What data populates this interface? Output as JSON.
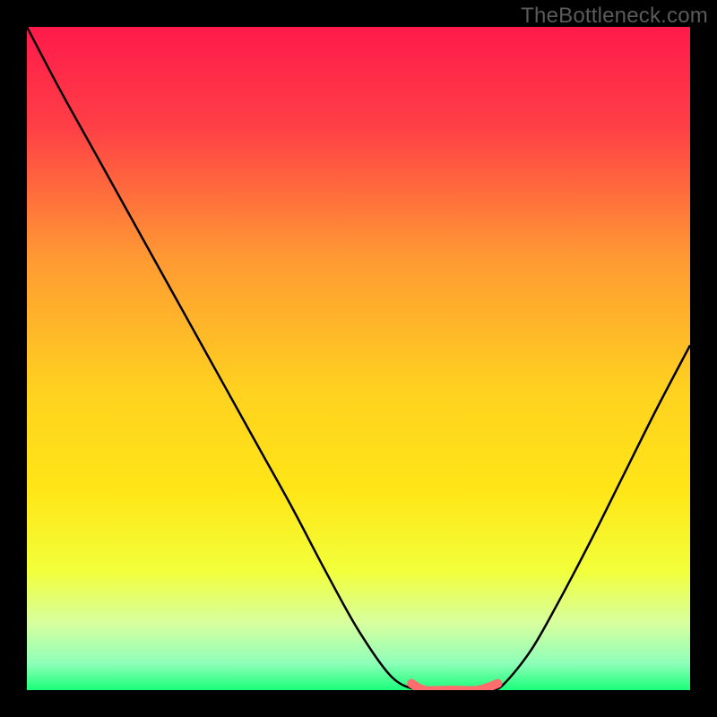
{
  "watermark": "TheBottleneck.com",
  "chart_data": {
    "type": "line",
    "title": "",
    "xlabel": "",
    "ylabel": "",
    "xlim": [
      0,
      1
    ],
    "ylim": [
      0,
      1
    ],
    "grid": false,
    "legend": false,
    "background": {
      "type": "vertical_gradient",
      "stops": [
        {
          "t": 0.0,
          "color": "#ff1a4b"
        },
        {
          "t": 0.15,
          "color": "#ff3f46"
        },
        {
          "t": 0.35,
          "color": "#ff9a33"
        },
        {
          "t": 0.55,
          "color": "#ffd21f"
        },
        {
          "t": 0.7,
          "color": "#ffe617"
        },
        {
          "t": 0.82,
          "color": "#f2ff3a"
        },
        {
          "t": 0.9,
          "color": "#d7ffa0"
        },
        {
          "t": 0.96,
          "color": "#8dffb8"
        },
        {
          "t": 1.0,
          "color": "#1aff7a"
        }
      ]
    },
    "series": [
      {
        "name": "bottleneck_curve",
        "stroke": "#000000",
        "stroke_width": 2.5,
        "x": [
          0.0,
          0.05,
          0.1,
          0.15,
          0.2,
          0.25,
          0.3,
          0.35,
          0.4,
          0.45,
          0.5,
          0.55,
          0.59,
          0.62,
          0.66,
          0.7,
          0.72,
          0.76,
          0.8,
          0.85,
          0.9,
          0.95,
          1.0
        ],
        "y": [
          1.0,
          0.905,
          0.815,
          0.725,
          0.635,
          0.545,
          0.455,
          0.365,
          0.275,
          0.18,
          0.09,
          0.02,
          0.0,
          0.0,
          0.0,
          0.0,
          0.01,
          0.06,
          0.13,
          0.225,
          0.325,
          0.425,
          0.52
        ]
      },
      {
        "name": "optimal_marker",
        "stroke": "#ff6e6e",
        "stroke_width": 10,
        "linecap": "round",
        "x": [
          0.58,
          0.6,
          0.64,
          0.68,
          0.71
        ],
        "y": [
          0.01,
          0.0,
          0.0,
          0.0,
          0.01
        ]
      }
    ],
    "annotations": []
  }
}
